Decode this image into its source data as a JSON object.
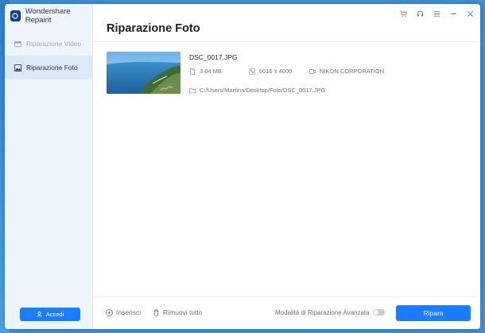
{
  "app": {
    "title": "Wondershare Repairit"
  },
  "sidebar": {
    "items": [
      {
        "label": "Riparazione Video",
        "icon": "video-icon",
        "active": false
      },
      {
        "label": "Riparazione Foto",
        "icon": "photo-icon",
        "active": true
      }
    ],
    "login_label": "Accedi"
  },
  "titlebar": {
    "icons": [
      "cart-icon",
      "headset-icon",
      "menu-icon",
      "minimize-icon",
      "close-icon"
    ]
  },
  "main": {
    "title": "Riparazione Foto",
    "file": {
      "name": "DSC_0017.JPG",
      "size": "3.84  MB",
      "dimensions": "6016 x 4000",
      "camera": "NIKON CORPORATION",
      "path": "C:/Users/Martina/Desktop/Foto/DSC_0017.JPG"
    }
  },
  "footer": {
    "add_label": "Inserisci",
    "remove_label": "Rimuovi tutto",
    "advanced_label": "Modalità di Riparazione Avanzata",
    "advanced_enabled": false,
    "repair_label": "Ripara"
  },
  "colors": {
    "accent": "#1a7cff",
    "cart_icon": "#e8734a",
    "sidebar_bg": "#eef4fb"
  }
}
